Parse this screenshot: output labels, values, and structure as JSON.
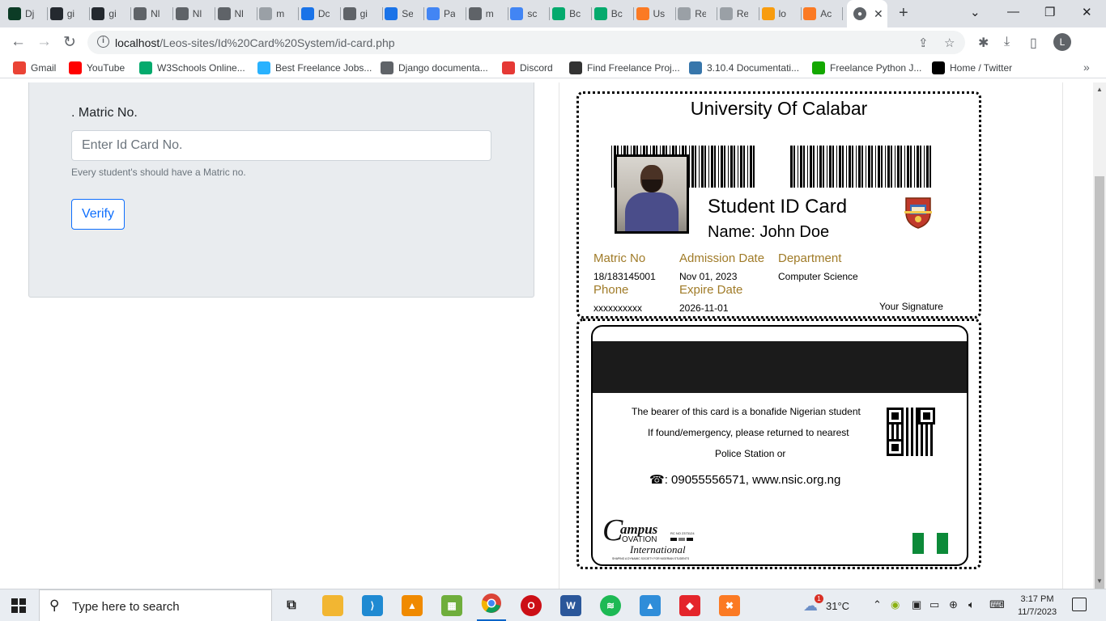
{
  "browser": {
    "tabs": [
      {
        "label": "Dj",
        "icon": "django-icon",
        "color": "#0c3c26"
      },
      {
        "label": "gi",
        "icon": "github-icon",
        "color": "#24292f"
      },
      {
        "label": "gi",
        "icon": "github-icon",
        "color": "#24292f"
      },
      {
        "label": "Nl",
        "icon": "globe-icon",
        "color": "#5f6368"
      },
      {
        "label": "Nl",
        "icon": "globe-icon",
        "color": "#5f6368"
      },
      {
        "label": "Nl",
        "icon": "globe-icon",
        "color": "#5f6368"
      },
      {
        "label": "m",
        "icon": "gmail-icon",
        "color": "#9aa0a6"
      },
      {
        "label": "Dc",
        "icon": "download-icon",
        "color": "#1a73e8"
      },
      {
        "label": "gi",
        "icon": "globe-icon",
        "color": "#5f6368"
      },
      {
        "label": "Se",
        "icon": "settings-icon",
        "color": "#1a73e8"
      },
      {
        "label": "Pa",
        "icon": "google-icon",
        "color": "#4285f4"
      },
      {
        "label": "m",
        "icon": "globe-icon",
        "color": "#5f6368"
      },
      {
        "label": "sc",
        "icon": "google-icon",
        "color": "#4285f4"
      },
      {
        "label": "Bc",
        "icon": "w3schools-icon",
        "color": "#04aa6d"
      },
      {
        "label": "Bc",
        "icon": "w3schools-icon",
        "color": "#04aa6d"
      },
      {
        "label": "Us",
        "icon": "xampp-icon",
        "color": "#fb7a24"
      },
      {
        "label": "Re",
        "icon": "document-icon",
        "color": "#9aa0a6"
      },
      {
        "label": "Re",
        "icon": "document-icon",
        "color": "#9aa0a6"
      },
      {
        "label": "lo",
        "icon": "phpmyadmin-icon",
        "color": "#f89c0e"
      },
      {
        "label": "Ac",
        "icon": "xampp-icon",
        "color": "#fb7a24"
      }
    ],
    "active_tab_icon": "globe-icon",
    "url_host": "localhost",
    "url_path": "/Leos-sites/Id%20Card%20System/id-card.php",
    "profile_initial": "L",
    "bookmarks": [
      {
        "label": "Gmail",
        "icon": "gmail-icon",
        "color": "#ea4335"
      },
      {
        "label": "YouTube",
        "icon": "youtube-icon",
        "color": "#ff0000"
      },
      {
        "label": "W3Schools Online...",
        "icon": "w3schools-icon",
        "color": "#04aa6d"
      },
      {
        "label": "Best Freelance Jobs...",
        "icon": "freelancer-icon",
        "color": "#29b2fe"
      },
      {
        "label": "Django documenta...",
        "icon": "globe-icon",
        "color": "#5f6368"
      },
      {
        "label": "Discord",
        "icon": "discord-icon",
        "color": "#e53935"
      },
      {
        "label": "Find Freelance Proj...",
        "icon": "tools-icon",
        "color": "#333333"
      },
      {
        "label": "3.10.4 Documentati...",
        "icon": "python-icon",
        "color": "#3776ab"
      },
      {
        "label": "Freelance Python J...",
        "icon": "upwork-icon",
        "color": "#14a800"
      },
      {
        "label": "Home / Twitter",
        "icon": "x-icon",
        "color": "#000000"
      }
    ]
  },
  "form": {
    "label": ". Matric No.",
    "placeholder": "Enter Id Card No.",
    "help": "Every student's should have a Matric no.",
    "button": "Verify"
  },
  "card": {
    "university": "University Of Calabar",
    "title": "Student ID Card",
    "name": "Name: John Doe",
    "fields": {
      "matric_label": "Matric No",
      "matric_value": "18/183145001",
      "admission_label": "Admission Date",
      "admission_value": "Nov 01, 2023",
      "department_label": "Department",
      "department_value": "Computer Science",
      "phone_label": "Phone",
      "phone_value": "xxxxxxxxxx",
      "expire_label": "Expire Date",
      "expire_value": "2026-11-01"
    },
    "signature": "Your Signature",
    "back": {
      "line1": "The bearer of this card is a bonafide Nigerian student",
      "line2": "If found/emergency, please returned to nearest",
      "line3": "Police Station or",
      "contact": ": 09055556571, www.nsic.org.ng",
      "logo_text": "Campus Ovation International",
      "logo_tagline": "SHAPING A DYNAMIC SOCIETY FOR NIGERIAN STUDENTS",
      "logo_rc": "RC NO 2373124"
    }
  },
  "taskbar": {
    "search_placeholder": "Type here to search",
    "weather": "31°C",
    "weather_badge": "1",
    "time": "3:17 PM",
    "date": "11/7/2023"
  }
}
